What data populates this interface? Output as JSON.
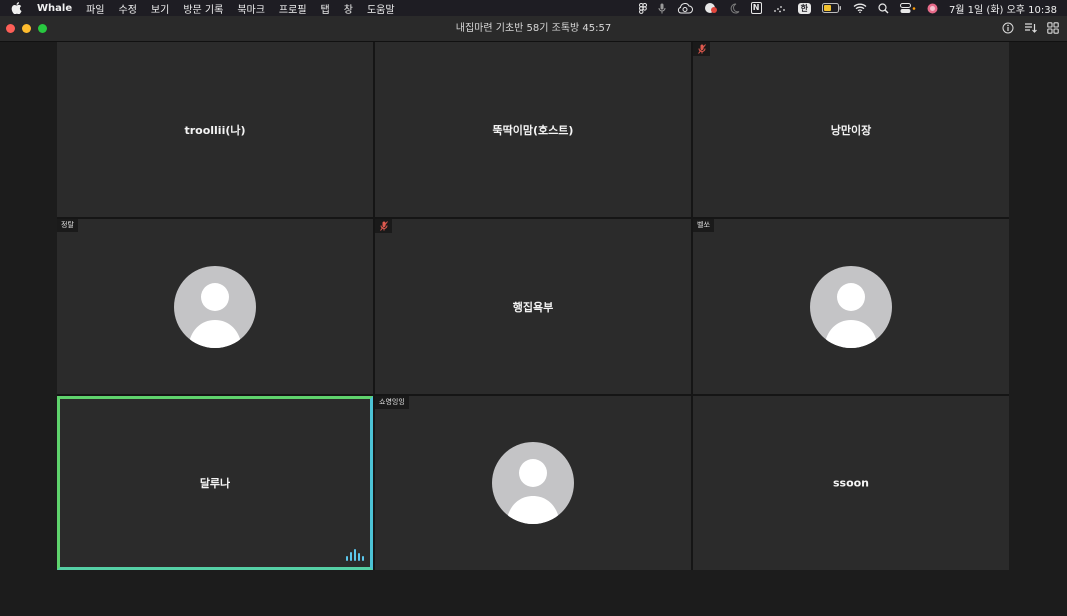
{
  "menubar": {
    "app_name": "Whale",
    "items": [
      "파일",
      "수정",
      "보기",
      "방문 기록",
      "북마크",
      "프로필",
      "탭",
      "창",
      "도움말"
    ],
    "input_source": "한",
    "notion_letter": "N",
    "clock": "7월 1일 (화) 오후 10:38"
  },
  "window": {
    "title": "내집마련 기초반 58기 조톡방 45:57"
  },
  "tiles": [
    {
      "name": "troollii(나)",
      "type": "name"
    },
    {
      "name": "뚝딱이맘(호스트)",
      "type": "name"
    },
    {
      "name": "낭만이장",
      "type": "name",
      "muted": true
    },
    {
      "name": "정탈",
      "type": "avatar"
    },
    {
      "name": "행집욕부",
      "type": "name",
      "muted": true
    },
    {
      "name": "벨쏘",
      "type": "avatar"
    },
    {
      "name": "달루나",
      "type": "name",
      "active_speaker": true
    },
    {
      "name": "쇼영잉잉",
      "type": "avatar"
    },
    {
      "name": "ssoon",
      "type": "name"
    }
  ],
  "colors": {
    "active_border": "#5fd36d",
    "mute_icon": "#e05a4f",
    "speaking_bars": "#5cc7ec"
  }
}
